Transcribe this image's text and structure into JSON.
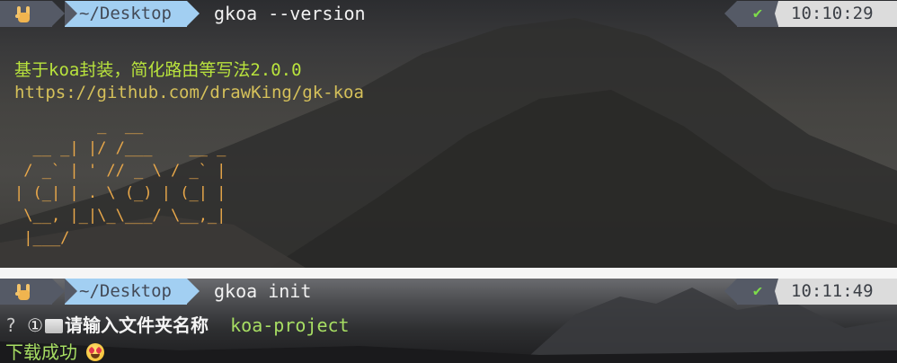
{
  "top_prompt": {
    "hand_icon": "rock-on-hand-icon",
    "directory": "~/Desktop",
    "command": "gkoa --version",
    "status_icon": "checkmark-icon",
    "status_glyph": "✔",
    "time": "10:10:29"
  },
  "output": {
    "slogan": "基于koa封装，简化路由等写法2.0.0",
    "url": "https://github.com/drawKing/gk-koa",
    "ascii_art": "         _  __\n  __ _| |/ /___    __ _\n / _` | ' // _ \\ / _` |\n| (_| | . \\ (_) | (_| |\n \\__, |_|\\_\\___/ \\__,_|\n |___/"
  },
  "bottom_prompt": {
    "hand_icon": "rock-on-hand-icon",
    "directory": "~/Desktop",
    "command": "gkoa init",
    "status_icon": "checkmark-icon",
    "status_glyph": "✔",
    "time": "10:11:49"
  },
  "question": {
    "mark": "?",
    "number_glyph": "①",
    "folder_icon": "folder-icon",
    "label": "请输入文件夹名称",
    "answer": "koa-project"
  },
  "result": {
    "message": "下载成功",
    "emoji_icon": "heart-eyes-emoji-icon"
  },
  "colors": {
    "prompt_dark": "#555a66",
    "prompt_dir": "#a2cff2",
    "time_bg": "#dcdcdc",
    "success_green": "#7ddc4a",
    "slogan_green": "#b9e33d",
    "url_yellow": "#d5c05a",
    "ascii_orange": "#e9a84a"
  }
}
